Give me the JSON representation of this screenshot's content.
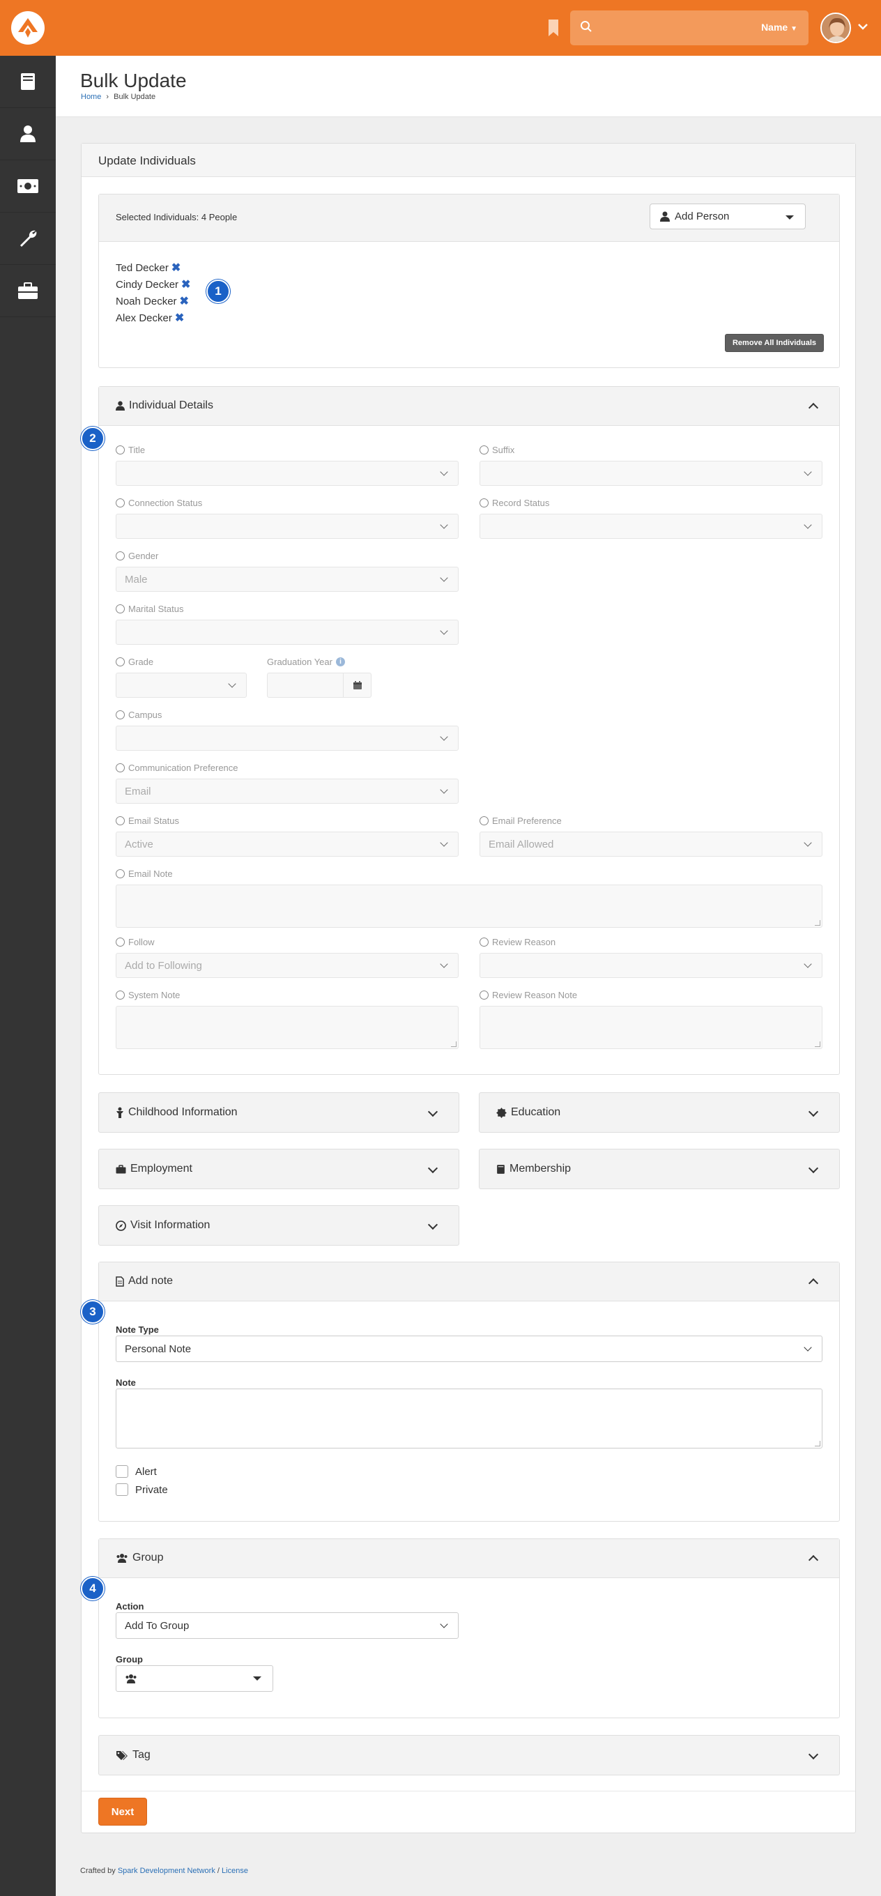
{
  "topbar": {
    "search_placeholder": "",
    "search_type": "Name"
  },
  "header": {
    "title": "Bulk Update",
    "breadcrumb_home": "Home",
    "breadcrumb_current": "Bulk Update"
  },
  "panel": {
    "title": "Update Individuals"
  },
  "selection": {
    "label": "Selected Individuals: 4 People",
    "add_person": "Add Person",
    "people": [
      "Ted Decker",
      "Cindy Decker",
      "Noah Decker",
      "Alex Decker"
    ],
    "remove_all": "Remove All Individuals"
  },
  "badges": [
    "1",
    "2",
    "3",
    "4"
  ],
  "individual_details": {
    "title": "Individual Details",
    "fields": {
      "title": {
        "label": "Title",
        "value": ""
      },
      "suffix": {
        "label": "Suffix",
        "value": ""
      },
      "connection_status": {
        "label": "Connection Status",
        "value": ""
      },
      "record_status": {
        "label": "Record Status",
        "value": ""
      },
      "gender": {
        "label": "Gender",
        "value": "Male"
      },
      "marital_status": {
        "label": "Marital Status",
        "value": ""
      },
      "grade": {
        "label": "Grade",
        "value": ""
      },
      "graduation_year": {
        "label": "Graduation Year",
        "value": ""
      },
      "campus": {
        "label": "Campus",
        "value": ""
      },
      "communication_preference": {
        "label": "Communication Preference",
        "value": "Email"
      },
      "email_status": {
        "label": "Email Status",
        "value": "Active"
      },
      "email_preference": {
        "label": "Email Preference",
        "value": "Email Allowed"
      },
      "email_note": {
        "label": "Email Note"
      },
      "follow": {
        "label": "Follow",
        "value": "Add to Following"
      },
      "review_reason": {
        "label": "Review Reason",
        "value": ""
      },
      "system_note": {
        "label": "System Note"
      },
      "review_reason_note": {
        "label": "Review Reason Note"
      }
    }
  },
  "sections": {
    "childhood": "Childhood Information",
    "education": "Education",
    "employment": "Employment",
    "membership": "Membership",
    "visit": "Visit Information",
    "tag": "Tag"
  },
  "add_note": {
    "title": "Add note",
    "note_type_label": "Note Type",
    "note_type_value": "Personal Note",
    "note_label": "Note",
    "alert_label": "Alert",
    "private_label": "Private"
  },
  "group": {
    "title": "Group",
    "action_label": "Action",
    "action_value": "Add To Group",
    "group_label": "Group"
  },
  "actions": {
    "next": "Next"
  },
  "footer": {
    "crafted_by": "Crafted by",
    "network": "Spark Development Network",
    "sep": "/",
    "license": "License"
  },
  "colors": {
    "brand_orange": "#ee7624",
    "sidebar": "#343434",
    "badge_blue": "#1a61c7",
    "link_blue": "#2a6fb5"
  }
}
